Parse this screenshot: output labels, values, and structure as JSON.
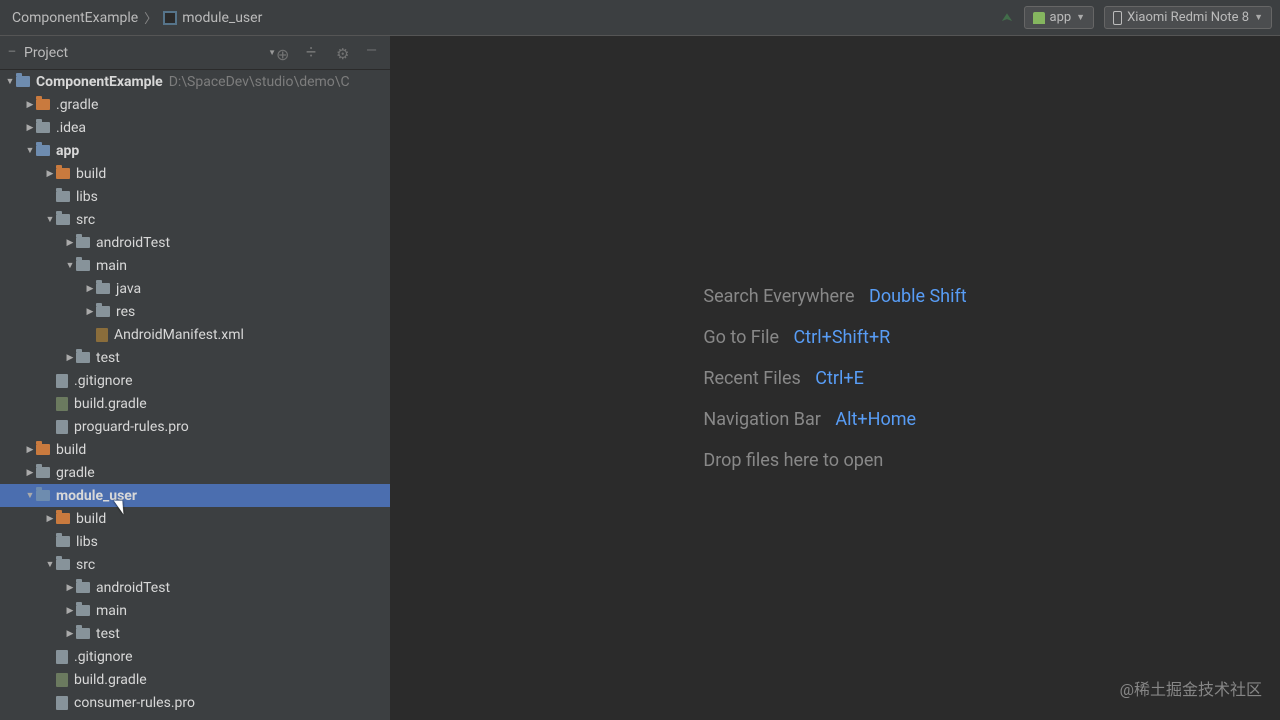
{
  "breadcrumb": {
    "root": "ComponentExample",
    "current": "module_user"
  },
  "toolbar": {
    "run_config": "app",
    "device": "Xiaomi Redmi Note 8"
  },
  "project_panel": {
    "title": "Project"
  },
  "tree": {
    "root": "ComponentExample",
    "root_path": "D:\\SpaceDev\\studio\\demo\\C",
    "items": [
      {
        "label": ".gradle"
      },
      {
        "label": ".idea"
      },
      {
        "label": "app"
      },
      {
        "label": "build"
      },
      {
        "label": "libs"
      },
      {
        "label": "src"
      },
      {
        "label": "androidTest"
      },
      {
        "label": "main"
      },
      {
        "label": "java"
      },
      {
        "label": "res"
      },
      {
        "label": "AndroidManifest.xml"
      },
      {
        "label": "test"
      },
      {
        "label": ".gitignore"
      },
      {
        "label": "build.gradle"
      },
      {
        "label": "proguard-rules.pro"
      },
      {
        "label": "build"
      },
      {
        "label": "gradle"
      },
      {
        "label": "module_user"
      },
      {
        "label": "build"
      },
      {
        "label": "libs"
      },
      {
        "label": "src"
      },
      {
        "label": "androidTest"
      },
      {
        "label": "main"
      },
      {
        "label": "test"
      },
      {
        "label": ".gitignore"
      },
      {
        "label": "build.gradle"
      },
      {
        "label": "consumer-rules.pro"
      }
    ]
  },
  "hints": {
    "search": {
      "label": "Search Everywhere",
      "key": "Double Shift"
    },
    "gotofile": {
      "label": "Go to File",
      "key": "Ctrl+Shift+R"
    },
    "recent": {
      "label": "Recent Files",
      "key": "Ctrl+E"
    },
    "navbar": {
      "label": "Navigation Bar",
      "key": "Alt+Home"
    },
    "drop": {
      "label": "Drop files here to open"
    }
  },
  "watermark": "@稀土掘金技术社区"
}
